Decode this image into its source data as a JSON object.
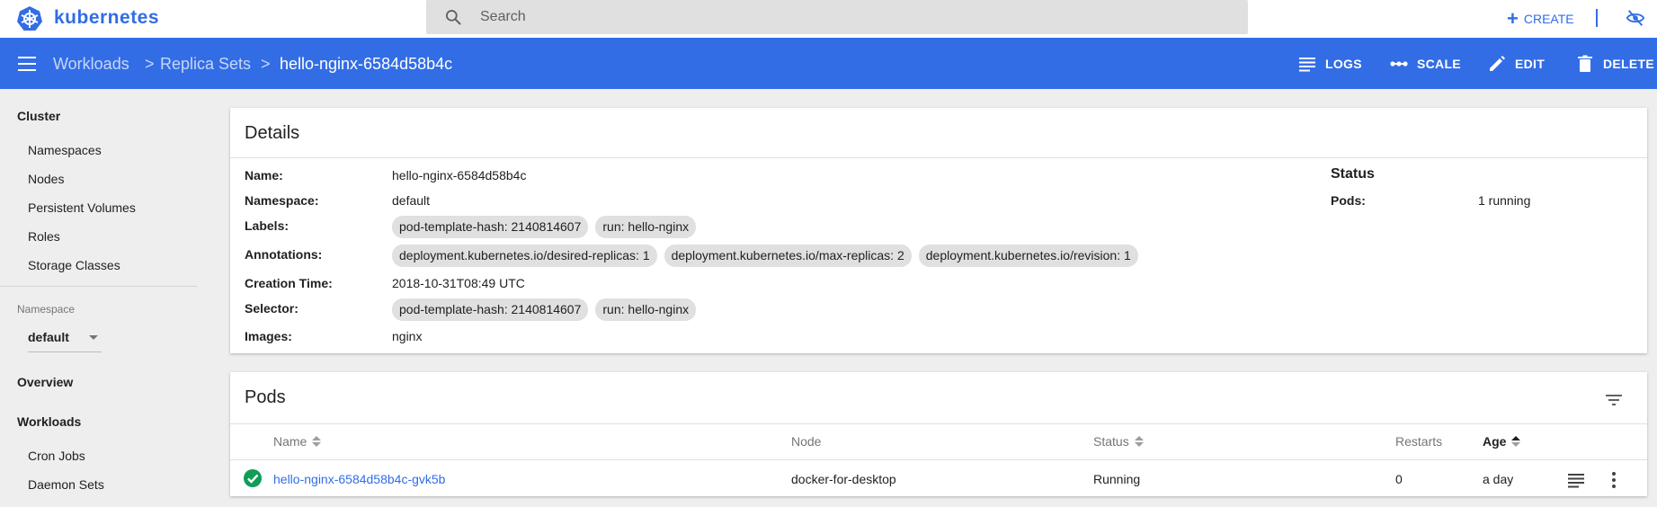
{
  "app": {
    "brand": "kubernetes"
  },
  "search": {
    "placeholder": "Search"
  },
  "topbar": {
    "create_label": "CREATE"
  },
  "breadcrumb": {
    "items": [
      "Workloads",
      "Replica Sets"
    ],
    "current": "hello-nginx-6584d58b4c",
    "separator": ">"
  },
  "actions": {
    "logs": "LOGS",
    "scale": "SCALE",
    "edit": "EDIT",
    "delete": "DELETE"
  },
  "sidebar": {
    "cluster_heading": "Cluster",
    "cluster_items": [
      "Namespaces",
      "Nodes",
      "Persistent Volumes",
      "Roles",
      "Storage Classes"
    ],
    "namespace_label": "Namespace",
    "namespace_value": "default",
    "overview": "Overview",
    "workloads_heading": "Workloads",
    "workloads_items": [
      "Cron Jobs",
      "Daemon Sets"
    ]
  },
  "details": {
    "title": "Details",
    "name_label": "Name:",
    "name": "hello-nginx-6584d58b4c",
    "namespace_label": "Namespace:",
    "namespace": "default",
    "labels_label": "Labels:",
    "labels": [
      "pod-template-hash: 2140814607",
      "run: hello-nginx"
    ],
    "annotations_label": "Annotations:",
    "annotations": [
      "deployment.kubernetes.io/desired-replicas:  1",
      "deployment.kubernetes.io/max-replicas:  2",
      "deployment.kubernetes.io/revision:  1"
    ],
    "creation_label": "Creation Time:",
    "creation_time": "2018-10-31T08:49 UTC",
    "selector_label": "Selector:",
    "selector": [
      "pod-template-hash: 2140814607",
      "run: hello-nginx"
    ],
    "images_label": "Images:",
    "images": "nginx",
    "status_title": "Status",
    "pods_label": "Pods:",
    "pods_value": "1 running"
  },
  "pods": {
    "title": "Pods",
    "columns": {
      "name": "Name",
      "node": "Node",
      "status": "Status",
      "restarts": "Restarts",
      "age": "Age"
    },
    "rows": [
      {
        "name": "hello-nginx-6584d58b4c-gvk5b",
        "node": "docker-for-desktop",
        "status": "Running",
        "restarts": "0",
        "age": "a day"
      }
    ]
  },
  "colors": {
    "accent": "#326de6",
    "ok": "#0f9d58"
  }
}
